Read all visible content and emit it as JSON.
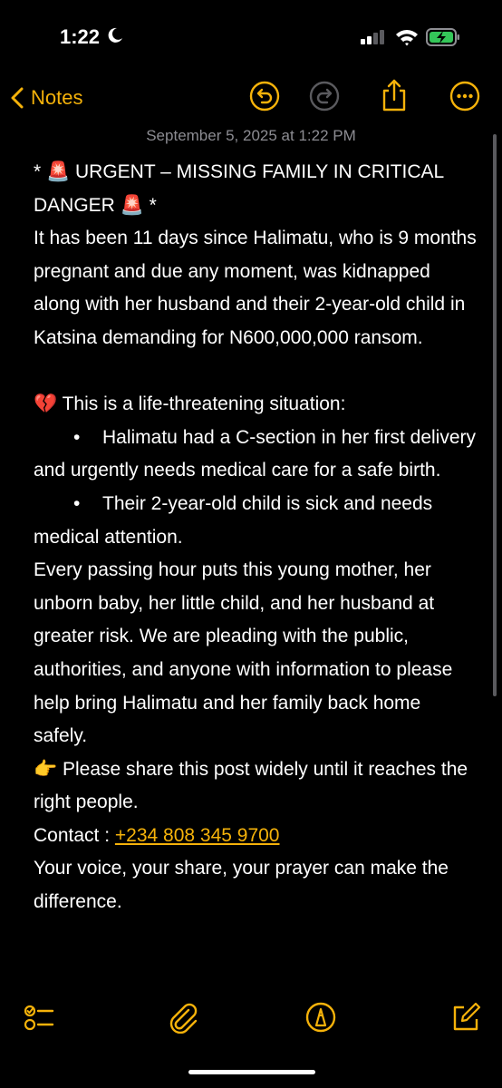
{
  "status_bar": {
    "time": "1:22",
    "moon_icon": "moon-icon",
    "signal_icon": "cellular-signal-icon",
    "wifi_icon": "wifi-icon",
    "battery_icon": "battery-charging-icon",
    "battery_color": "#34c759"
  },
  "nav": {
    "back_label": "Notes",
    "accent": "#f5b20a",
    "icons": [
      "undo-icon",
      "redo-icon",
      "share-icon",
      "more-icon"
    ]
  },
  "note": {
    "date": "September 5, 2025 at 1:22 PM",
    "line1": "* 🚨 URGENT – MISSING FAMILY IN CRITICAL DANGER 🚨 *",
    "para1": "It has been 11 days since Halimatu, who is 9 months pregnant and due any moment, was kidnapped along with her husband and their 2-year-old child in Katsina demanding for N600,000,000 ransom.",
    "situation": "💔  This is a life-threatening situation:",
    "bullet_char": "•",
    "bullet1": "Halimatu had a C-section in her first delivery and urgently needs medical care for a safe birth.",
    "bullet2": "Their 2-year-old child is sick and needs medical attention.",
    "para2": "Every passing hour puts this young mother, her unborn baby, her little child, and her husband at greater risk. We are pleading with the public, authorities, and anyone with information to please help bring Halimatu and her family back home safely.",
    "share": "👉 Please share this post widely until it reaches the right people.",
    "contact_label": "Contact : ",
    "contact_phone": "+234 808 345 9700",
    "closing": "Your voice, your share, your prayer can make the difference."
  },
  "toolbar": {
    "icons": [
      "checklist-icon",
      "attachment-icon",
      "markup-icon",
      "compose-icon"
    ]
  }
}
